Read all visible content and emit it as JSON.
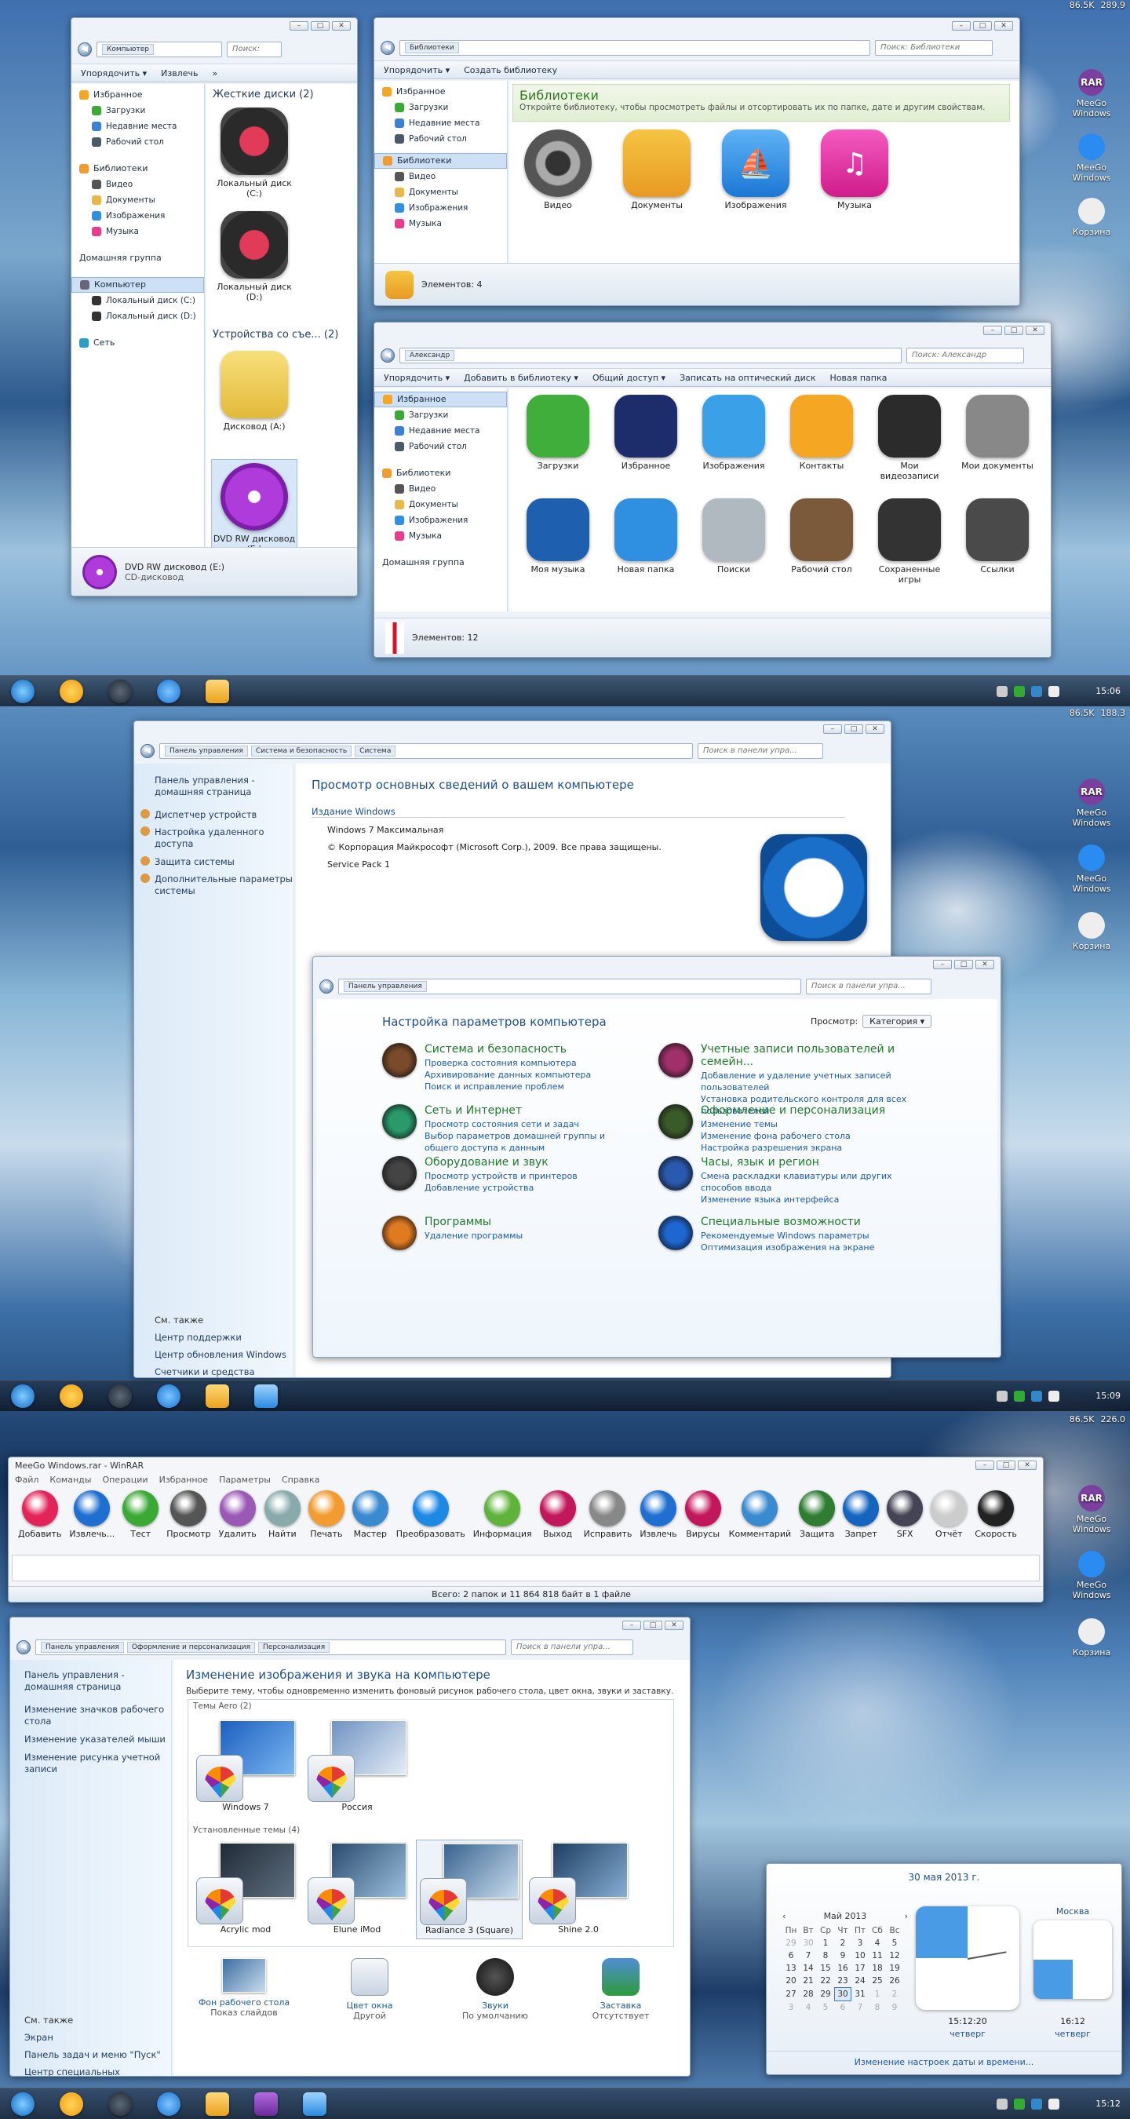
{
  "top_gadget": {
    "net": "86.5K",
    "cpu": "289.9"
  },
  "mid_gadget": {
    "net": "86.5K",
    "cpu": "188.3"
  },
  "low_gadget": {
    "net": "86.5K",
    "cpu": "226.0"
  },
  "desktop_icons": [
    {
      "label": "MeeGo Windows",
      "badge": "RAR"
    },
    {
      "label": "MeeGo Windows"
    },
    {
      "label": "Корзина"
    }
  ],
  "computer_window": {
    "crumb": "Компьютер",
    "search": "Поиск:",
    "toolbar": [
      "Упорядочить ▾",
      "Извлечь",
      "»"
    ],
    "nav": {
      "fav": "Избранное",
      "fav_items": [
        "Загрузки",
        "Недавние места",
        "Рабочий стол"
      ],
      "lib": "Библиотеки",
      "lib_items": [
        "Видео",
        "Документы",
        "Изображения",
        "Музыка"
      ],
      "home": "Домашняя группа",
      "comp": "Компьютер",
      "comp_items": [
        "Локальный диск (C:)",
        "Локальный диск (D:)"
      ],
      "net": "Сеть"
    },
    "group1": "Жесткие диски (2)",
    "drive_c": "Локальный диск (C:)",
    "drive_d": "Локальный диск (D:)",
    "group2": "Устройства со съе... (2)",
    "floppy": "Дисковод (A:)",
    "dvd": "DVD RW дисковод (E:)",
    "status_title": "DVD RW дисковод (E:)",
    "status_sub": "CD-дисковод"
  },
  "libraries_window": {
    "crumb": "Библиотеки",
    "search": "Поиск: Библиотеки",
    "toolbar": [
      "Упорядочить ▾",
      "Создать библиотеку"
    ],
    "nav": {
      "fav": "Избранное",
      "fav_items": [
        "Загрузки",
        "Недавние места",
        "Рабочий стол"
      ],
      "lib": "Библиотеки",
      "lib_items": [
        "Видео",
        "Документы",
        "Изображения",
        "Музыка"
      ]
    },
    "banner_title": "Библиотеки",
    "banner_text": "Откройте библиотеку, чтобы просмотреть файлы и отсортировать их по папке, дате и другим свойствам.",
    "items": [
      "Видео",
      "Документы",
      "Изображения",
      "Музыка"
    ],
    "status": "Элементов: 4"
  },
  "user_window": {
    "crumb": "Александр",
    "search": "Поиск: Александр",
    "toolbar": [
      "Упорядочить ▾",
      "Добавить в библиотеку ▾",
      "Общий доступ ▾",
      "Записать на оптический диск",
      "Новая папка"
    ],
    "nav": {
      "fav": "Избранное",
      "fav_items": [
        "Загрузки",
        "Недавние места",
        "Рабочий стол"
      ],
      "lib": "Библиотеки",
      "lib_items": [
        "Видео",
        "Документы",
        "Изображения",
        "Музыка"
      ],
      "home": "Домашняя группа"
    },
    "items": [
      "Загрузки",
      "Избранное",
      "Изображения",
      "Контакты",
      "Мои видеозаписи",
      "Мои документы",
      "Моя музыка",
      "Новая папка",
      "Поиски",
      "Рабочий стол",
      "Сохраненные игры",
      "Ссылки"
    ],
    "status": "Элементов: 12"
  },
  "taskbar_times": [
    "15:06",
    "15:09",
    "15:12"
  ],
  "system_window": {
    "crumbs": [
      "Панель управления",
      "Система и безопасность",
      "Система"
    ],
    "search": "Поиск в панели упра...",
    "side": [
      "Панель управления - домашняя страница",
      "Диспетчер устройств",
      "Настройка удаленного доступа",
      "Защита системы",
      "Дополнительные параметры системы"
    ],
    "see_also": "См. также",
    "see_links": [
      "Центр поддержки",
      "Центр обновления Windows",
      "Счетчики и средства производительности"
    ],
    "heading": "Просмотр основных сведений о вашем компьютере",
    "edition_label": "Издание Windows",
    "edition": "Windows 7 Максимальная",
    "copyright": "© Корпорация Майкрософт (Microsoft Corp.), 2009. Все права защищены.",
    "sp": "Service Pack 1"
  },
  "cp_window": {
    "crumb": "Панель управления",
    "search": "Поиск в панели упра...",
    "heading": "Настройка параметров компьютера",
    "view_label": "Просмотр:",
    "view_value": "Категория ▾",
    "cats": [
      {
        "title": "Система и безопасность",
        "links": [
          "Проверка состояния компьютера",
          "Архивирование данных компьютера",
          "Поиск и исправление проблем"
        ]
      },
      {
        "title": "Сеть и Интернет",
        "links": [
          "Просмотр состояния сети и задач",
          "Выбор параметров домашней группы и общего доступа к данным"
        ]
      },
      {
        "title": "Оборудование и звук",
        "links": [
          "Просмотр устройств и принтеров",
          "Добавление устройства"
        ]
      },
      {
        "title": "Программы",
        "links": [
          "Удаление программы"
        ]
      },
      {
        "title": "Учетные записи пользователей и семейн...",
        "links": [
          "Добавление и удаление учетных записей пользователей",
          "Установка родительского контроля для всех пользователей"
        ]
      },
      {
        "title": "Оформление и персонализация",
        "links": [
          "Изменение темы",
          "Изменение фона рабочего стола",
          "Настройка разрешения экрана"
        ]
      },
      {
        "title": "Часы, язык и регион",
        "links": [
          "Смена раскладки клавиатуры или других способов ввода",
          "Изменение языка интерфейса"
        ]
      },
      {
        "title": "Специальные возможности",
        "links": [
          "Рекомендуемые Windows параметры",
          "Оптимизация изображения на экране"
        ]
      }
    ]
  },
  "winrar": {
    "title": "MeeGo Windows.rar - WinRAR",
    "menu": [
      "Файл",
      "Команды",
      "Операции",
      "Избранное",
      "Параметры",
      "Справка"
    ],
    "tools": [
      "Добавить",
      "Извлечь...",
      "Тест",
      "Просмотр",
      "Удалить",
      "Найти",
      "Печать",
      "Мастер",
      "Преобразовать",
      "Информация",
      "Выход",
      "Исправить",
      "Извлечь",
      "Вирусы",
      "Комментарий",
      "Защита",
      "Запрет",
      "SFX",
      "Отчёт",
      "Скорость"
    ],
    "status": "Всего: 2 папок и 11 864 818 байт в 1 файле"
  },
  "pers_window": {
    "crumbs": [
      "Панель управления",
      "Оформление и персонализация",
      "Персонализация"
    ],
    "search": "Поиск в панели упра...",
    "side": [
      "Панель управления - домашняя страница",
      "Изменение значков рабочего стола",
      "Изменение указателей мыши",
      "Изменение рисунка учетной записи"
    ],
    "see_also": "См. также",
    "see_links": [
      "Экран",
      "Панель задач и меню \"Пуск\"",
      "Центр специальных возможностей"
    ],
    "heading": "Изменение изображения и звука на компьютере",
    "sub": "Выберите тему, чтобы одновременно изменить фоновый рисунок рабочего стола, цвет окна, звуки и заставку.",
    "aero": "Темы Aero (2)",
    "aero_themes": [
      "Windows 7",
      "Россия"
    ],
    "installed": "Установленные темы (4)",
    "installed_themes": [
      "Acrylic mod",
      "Elune iMod",
      "Radiance 3 (Square)",
      "Shine 2.0"
    ],
    "bottom": [
      {
        "t": "Фон рабочего стола",
        "s": "Показ слайдов"
      },
      {
        "t": "Цвет окна",
        "s": "Другой"
      },
      {
        "t": "Звуки",
        "s": "По умолчанию"
      },
      {
        "t": "Заставка",
        "s": "Отсутствует"
      }
    ]
  },
  "calendar": {
    "date": "30 мая 2013 г.",
    "month": "Май 2013",
    "days": [
      "Пн",
      "Вт",
      "Ср",
      "Чт",
      "Пт",
      "Сб",
      "Вс"
    ],
    "rows": [
      [
        "29",
        "30",
        "1",
        "2",
        "3",
        "4",
        "5"
      ],
      [
        "6",
        "7",
        "8",
        "9",
        "10",
        "11",
        "12"
      ],
      [
        "13",
        "14",
        "15",
        "16",
        "17",
        "18",
        "19"
      ],
      [
        "20",
        "21",
        "22",
        "23",
        "24",
        "25",
        "26"
      ],
      [
        "27",
        "28",
        "29",
        "30",
        "31",
        "1",
        "2"
      ],
      [
        "3",
        "4",
        "5",
        "6",
        "7",
        "8",
        "9"
      ]
    ],
    "clock1_time": "15:12:20",
    "clock1_day": "четверг",
    "clock2_city": "Москва",
    "clock2_time": "16:12",
    "clock2_day": "четверг",
    "link": "Изменение настроек даты и времени..."
  }
}
